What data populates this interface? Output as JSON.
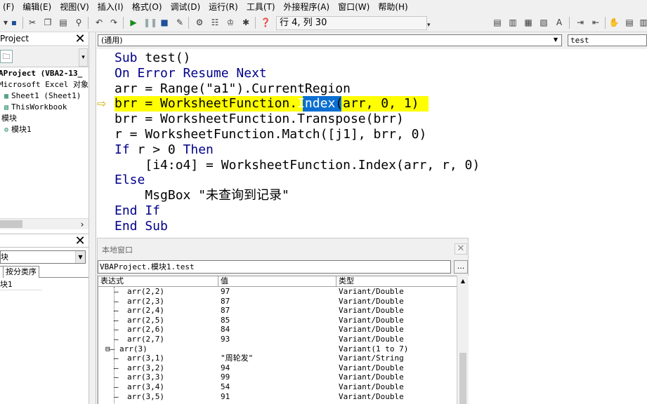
{
  "menu": [
    "(F)",
    "编辑(E)",
    "视图(V)",
    "插入(I)",
    "格式(O)",
    "调试(D)",
    "运行(R)",
    "工具(T)",
    "外接程序(A)",
    "窗口(W)",
    "帮助(H)"
  ],
  "toolbar": {
    "position": "行 4, 列 30"
  },
  "project_pane": {
    "title": "Project",
    "close": "✕",
    "tree": [
      {
        "text": "AProject (VBA2-13_",
        "icon": ""
      },
      {
        "text": "Microsoft Excel 对象",
        "icon": ""
      },
      {
        "text": "Sheet1 (Sheet1)",
        "icon": "sheet-icon"
      },
      {
        "text": "ThisWorkbook",
        "icon": "workbook-icon"
      },
      {
        "text": "模块",
        "icon": ""
      },
      {
        "text": "模块1",
        "icon": "module-icon"
      }
    ]
  },
  "properties_pane": {
    "close": "✕",
    "select_value": "块",
    "tabs": [
      "",
      "按分类序"
    ],
    "row": "块1"
  },
  "code_window": {
    "object_combo": "(通用)",
    "procedure_combo": "test",
    "lines": [
      {
        "pre": "",
        "kw": "Sub ",
        "rest": "test()"
      },
      {
        "pre": "",
        "kw": "On Error Resume Next",
        "rest": ""
      },
      {
        "pre": "",
        "kw": "",
        "rest": "arr = Range(\"a1\").CurrentRegion"
      },
      {
        "pre": "",
        "kw": "",
        "rest": "brr = WorksheetFunction.Index(arr, 0, 1)"
      },
      {
        "pre": "",
        "kw": "",
        "rest": "brr = WorksheetFunction.Transpose(brr)"
      },
      {
        "pre": "",
        "kw": "",
        "rest": "r = WorksheetFunction.Match([j1], brr, 0)"
      },
      {
        "pre": "",
        "kw": "If ",
        "rest": "r > 0 Then"
      },
      {
        "pre": "    ",
        "kw": "",
        "rest": "[i4:o4] = WorksheetFunction.Index(arr, r, 0)"
      },
      {
        "pre": "",
        "kw": "Else",
        "rest": ""
      },
      {
        "pre": "    ",
        "kw": "",
        "rest": "MsgBox \"未查询到记录\""
      },
      {
        "pre": "",
        "kw": "End If",
        "rest": ""
      },
      {
        "pre": "",
        "kw": "End Sub",
        "rest": ""
      }
    ]
  },
  "locals": {
    "title": "本地窗口",
    "close": "✕",
    "context": "VBAProject.模块1.test",
    "context_btn": "...",
    "columns": [
      "表达式",
      "值",
      "类型"
    ],
    "rows": [
      {
        "expr": "arr(2,2)",
        "value": "97",
        "type": "Variant/Double",
        "level": 2
      },
      {
        "expr": "arr(2,3)",
        "value": "87",
        "type": "Variant/Double",
        "level": 2
      },
      {
        "expr": "arr(2,4)",
        "value": "87",
        "type": "Variant/Double",
        "level": 2
      },
      {
        "expr": "arr(2,5)",
        "value": "85",
        "type": "Variant/Double",
        "level": 2
      },
      {
        "expr": "arr(2,6)",
        "value": "84",
        "type": "Variant/Double",
        "level": 2
      },
      {
        "expr": "arr(2,7)",
        "value": "93",
        "type": "Variant/Double",
        "level": 2
      },
      {
        "expr": "arr(3)",
        "value": "",
        "type": "Variant(1 to 7)",
        "level": 1
      },
      {
        "expr": "arr(3,1)",
        "value": "\"周轮发\"",
        "type": "Variant/String",
        "level": 2
      },
      {
        "expr": "arr(3,2)",
        "value": "94",
        "type": "Variant/Double",
        "level": 2
      },
      {
        "expr": "arr(3,3)",
        "value": "99",
        "type": "Variant/Double",
        "level": 2
      },
      {
        "expr": "arr(3,4)",
        "value": "54",
        "type": "Variant/Double",
        "level": 2
      },
      {
        "expr": "arr(3,5)",
        "value": "91",
        "type": "Variant/Double",
        "level": 2
      }
    ]
  },
  "colors": {
    "keyword": "#00008b",
    "exec_line": "#ffff00",
    "selection": "#0b6fd1"
  }
}
